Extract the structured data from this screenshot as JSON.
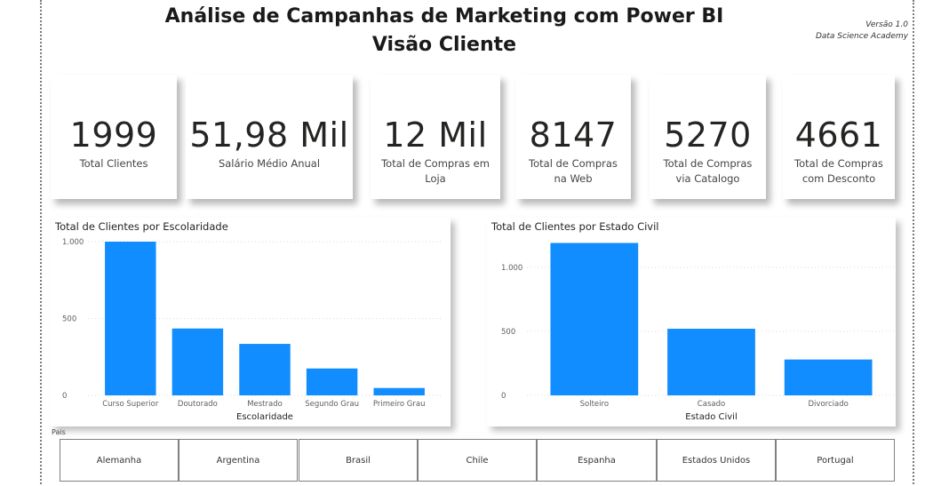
{
  "header": {
    "title_line1": "Análise de Campanhas de Marketing com Power BI",
    "title_line2": "Visão Cliente",
    "version": "Versão 1.0",
    "org": "Data Science Academy"
  },
  "kpis": [
    {
      "value": "1999",
      "label": "Total Clientes"
    },
    {
      "value": "51,98 Mil",
      "label": "Salário Médio Anual"
    },
    {
      "value": "12 Mil",
      "label": "Total de Compras em Loja"
    },
    {
      "value": "8147",
      "label": "Total de Compras na Web"
    },
    {
      "value": "5270",
      "label": "Total de Compras via Catalogo"
    },
    {
      "value": "4661",
      "label": "Total de Compras com Desconto"
    }
  ],
  "colors": {
    "bar": "#118DFF",
    "grid": "#d9d9d9"
  },
  "chart_data": [
    {
      "type": "bar",
      "title": "Total de Clientes por Escolaridade",
      "xlabel": "Escolaridade",
      "ylabel": "",
      "categories": [
        "Curso Superior",
        "Doutorado",
        "Mestrado",
        "Segundo Grau",
        "Primeiro Grau"
      ],
      "values": [
        1000,
        435,
        335,
        175,
        48
      ],
      "ylim": [
        0,
        1000
      ],
      "yticks": [
        0,
        500,
        1000
      ],
      "ytick_labels": [
        "0",
        "500",
        "1.000"
      ],
      "grid": true
    },
    {
      "type": "bar",
      "title": "Total de Clientes por Estado Civil",
      "xlabel": "Estado Civil",
      "ylabel": "",
      "categories": [
        "Solteiro",
        "Casado",
        "Divorciado"
      ],
      "values": [
        1190,
        520,
        280
      ],
      "ylim": [
        0,
        1200
      ],
      "yticks": [
        0,
        500,
        1000
      ],
      "ytick_labels": [
        "0",
        "500",
        "1.000"
      ],
      "grid": true
    }
  ],
  "slicer": {
    "label": "Pais",
    "options": [
      "Alemanha",
      "Argentina",
      "Brasil",
      "Chile",
      "Espanha",
      "Estados Unidos",
      "Portugal"
    ]
  }
}
